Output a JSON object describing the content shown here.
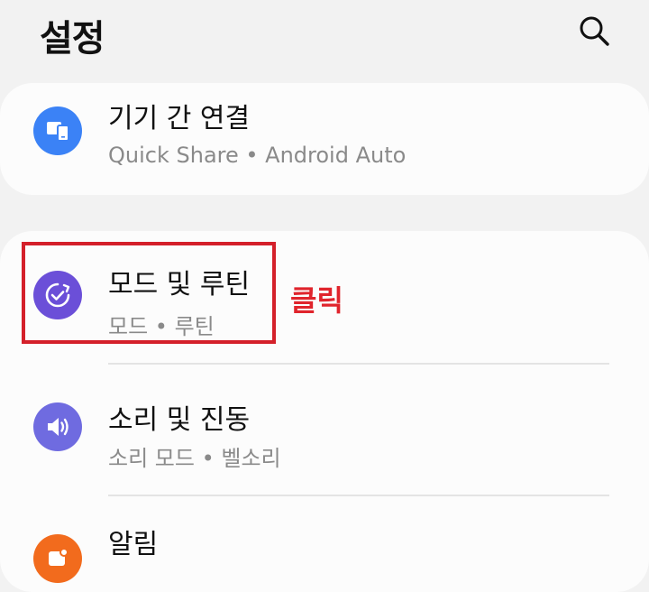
{
  "header": {
    "title": "설정",
    "search_icon": "search-icon"
  },
  "cards": [
    {
      "items": [
        {
          "title": "기기 간 연결",
          "subtitle": "Quick Share  •  Android Auto",
          "icon": "devices-icon",
          "icon_color": "#3b82f6"
        }
      ]
    },
    {
      "items": [
        {
          "title": "모드 및 루틴",
          "subtitle": "모드  •  루틴",
          "icon": "modes-routines-icon",
          "icon_color": "#6b4fd8"
        },
        {
          "title": "소리 및 진동",
          "subtitle": "소리 모드  •  벨소리",
          "icon": "sound-icon",
          "icon_color": "#6f6be0"
        },
        {
          "title": "알림",
          "subtitle": "",
          "icon": "notifications-icon",
          "icon_color": "#f26b1d"
        }
      ]
    }
  ],
  "annotation": {
    "label": "클릭",
    "color": "#d4202a"
  }
}
